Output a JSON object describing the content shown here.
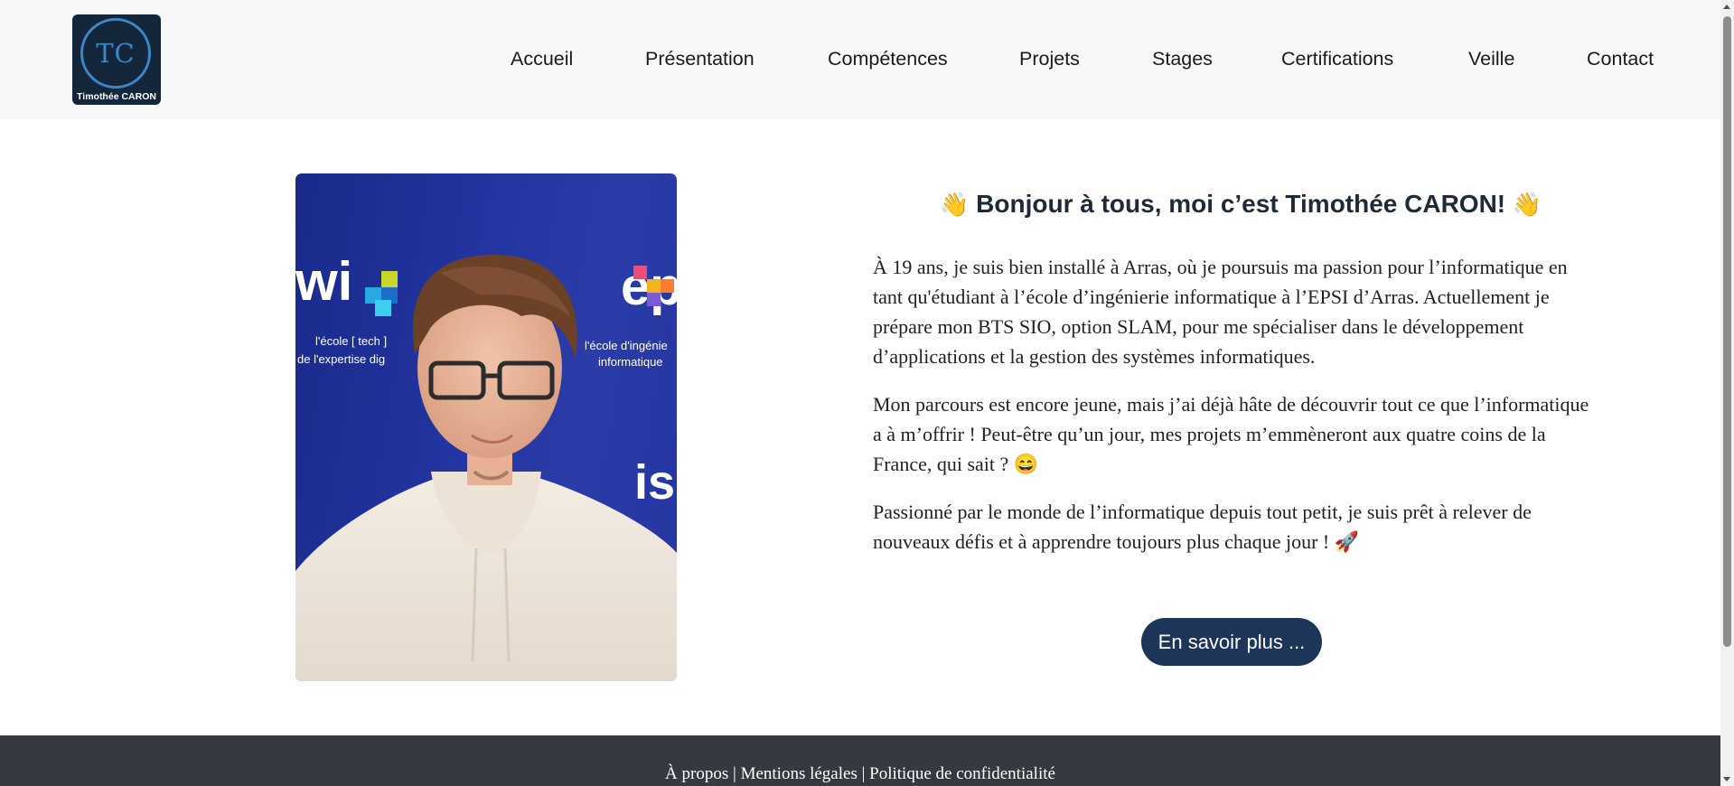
{
  "header": {
    "logo": {
      "initials": "TC",
      "name": "Timothée CARON"
    },
    "nav": [
      "Accueil",
      "Présentation",
      "Compétences",
      "Projets",
      "Stages",
      "Certifications",
      "Veille",
      "Contact"
    ]
  },
  "photo": {
    "banner_text_1": "l'école [ tech ]",
    "banner_text_2": "de l'expertise dig",
    "banner_text_3": "l'école d'ingénie",
    "banner_text_4": "informatique",
    "brand_left": "wi",
    "brand_right": "epsi",
    "brand_bottom": "isi"
  },
  "main": {
    "wave_left": "👋",
    "heading": "Bonjour à tous, moi c’est Timothée CARON!",
    "wave_right": "👋",
    "paragraphs": [
      "À 19 ans, je suis bien installé à Arras, où je poursuis ma passion pour l’informatique en tant qu'étudiant à l’école d’ingénierie informatique à l’EPSI d’Arras. Actuellement je prépare mon BTS SIO, option SLAM, pour me spécialiser dans le développement d’applications et la gestion des systèmes informatiques.",
      "Mon parcours est encore jeune, mais j’ai déjà hâte de découvrir tout ce que l’informatique a à m’offrir ! Peut-être qu’un jour, mes projets m’emmèneront aux quatre coins de la France, qui sait ? 😄",
      "Passionné par le monde de l’informatique depuis tout petit, je suis prêt à relever de nouveaux défis et à apprendre toujours plus chaque jour ! 🚀"
    ],
    "cta": "En savoir plus ..."
  },
  "footer": {
    "links": [
      "À propos",
      "Mentions légales",
      "Politique de confidentialité"
    ],
    "separator": " | "
  },
  "colors": {
    "header_bg": "#f7f8fa",
    "logo_bg": "#14263a",
    "logo_accent": "#3f86c6",
    "cta_bg": "#1d3558",
    "footer_bg": "#343a40",
    "photo_bg": "#21349f"
  }
}
